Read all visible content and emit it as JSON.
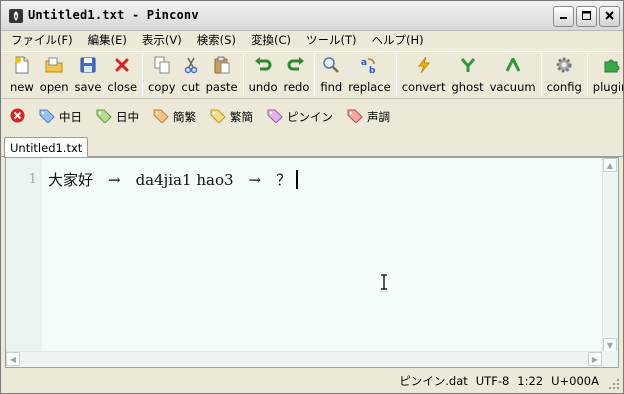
{
  "window": {
    "title": "Untitled1.txt - Pinconv"
  },
  "menu": [
    "ファイル(F)",
    "編集(E)",
    "表示(V)",
    "検索(S)",
    "変換(C)",
    "ツール(T)",
    "ヘルプ(H)"
  ],
  "toolbar": {
    "new": "new",
    "open": "open",
    "save": "save",
    "close": "close",
    "copy": "copy",
    "cut": "cut",
    "paste": "paste",
    "undo": "undo",
    "redo": "redo",
    "find": "find",
    "replace": "replace",
    "convert": "convert",
    "ghost": "ghost",
    "vacuum": "vacuum",
    "config": "config",
    "plugin": "plugin"
  },
  "tags": [
    "中日",
    "日中",
    "簡繁",
    "繁簡",
    "ピンイン",
    "声調"
  ],
  "tab": {
    "label": "Untitled1.txt"
  },
  "editor": {
    "line_number": "1",
    "text": "大家好　→　da4jia1 hao3　→　？"
  },
  "status": {
    "dict": "ピンイン.dat",
    "encoding": "UTF-8",
    "position": "1:22",
    "char": "U+000A"
  },
  "colors": {
    "editor_bg": "#f3fbfb",
    "chrome": "#ece9d8",
    "close_red": "#e02020"
  }
}
